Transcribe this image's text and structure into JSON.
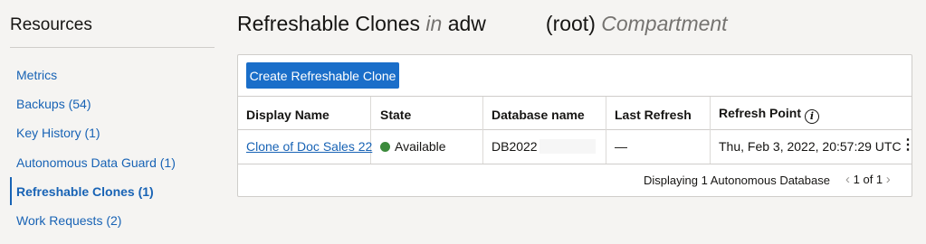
{
  "sidebar": {
    "title": "Resources",
    "items": [
      {
        "label": "Metrics"
      },
      {
        "label": "Backups (54)"
      },
      {
        "label": "Key History (1)"
      },
      {
        "label": "Autonomous Data Guard (1)"
      },
      {
        "label": "Refreshable Clones (1)",
        "active": true
      },
      {
        "label": "Work Requests (2)"
      }
    ]
  },
  "header": {
    "title": "Refreshable Clones",
    "in_word": "in",
    "compartment_name": "adw",
    "root_label": "(root)",
    "compartment_word": "Compartment"
  },
  "toolbar": {
    "create_label": "Create Refreshable Clone"
  },
  "table": {
    "columns": [
      "Display Name",
      "State",
      "Database name",
      "Last Refresh",
      "Refresh Point"
    ],
    "rows": [
      {
        "display_name": "Clone of Doc Sales 22",
        "state": "Available",
        "state_color": "#3b8a3b",
        "database_name": "DB2022",
        "last_refresh": "—",
        "refresh_point": "Thu, Feb 3, 2022, 20:57:29 UTC"
      }
    ],
    "footer": "Displaying 1 Autonomous Database",
    "pagination": "1 of 1"
  },
  "icons": {
    "info": "info-icon",
    "kebab": "kebab-menu-icon",
    "prev": "chevron-left-icon",
    "next": "chevron-right-icon"
  },
  "colors": {
    "accent": "#1a6ec9",
    "link": "#1863b5",
    "available": "#3b8a3b"
  }
}
